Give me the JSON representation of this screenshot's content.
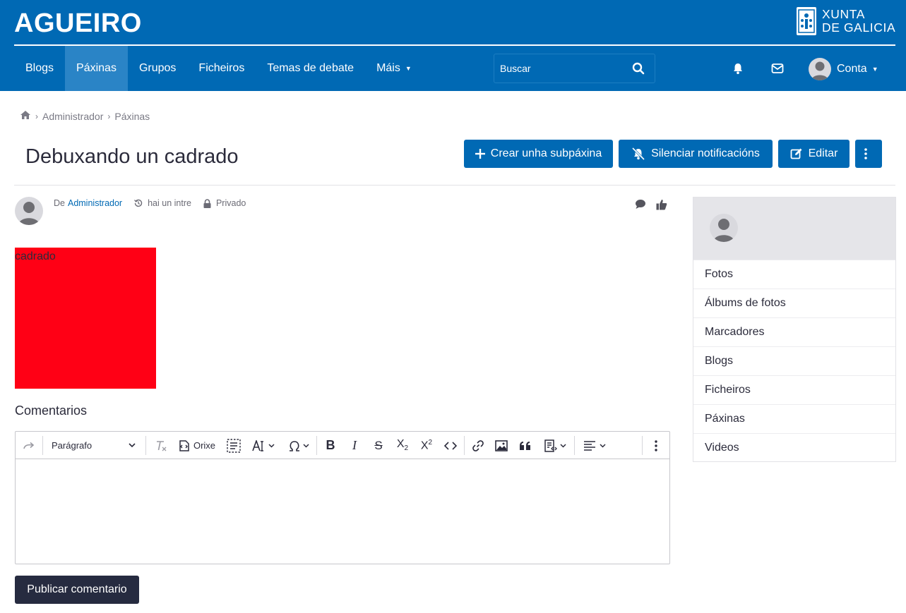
{
  "header": {
    "brand": "AGUEIRO",
    "org_line1": "XUNTA",
    "org_line2": "DE GALICIA",
    "nav": [
      {
        "label": "Blogs"
      },
      {
        "label": "Páxinas",
        "active": true
      },
      {
        "label": "Grupos"
      },
      {
        "label": "Ficheiros"
      },
      {
        "label": "Temas de debate"
      },
      {
        "label": "Máis"
      }
    ],
    "search_placeholder": "Buscar",
    "account_label": "Conta"
  },
  "breadcrumb": [
    "Administrador",
    "Páxinas"
  ],
  "page": {
    "title": "Debuxando un cadrado",
    "actions": {
      "create_subpage": "Crear unha subpáxina",
      "mute": "Silenciar notificacións",
      "edit": "Editar"
    },
    "meta": {
      "by_prefix": "De",
      "author": "Administrador",
      "time": "hai un intre",
      "access": "Privado"
    },
    "content_text": "cadrado",
    "content_color": "#ff0015"
  },
  "comments": {
    "title": "Comentarios",
    "paragraph_select": "Parágrafo",
    "source_label": "Orixe",
    "publish_label": "Publicar comentario"
  },
  "sidebar": {
    "items": [
      "Fotos",
      "Álbums de fotos",
      "Marcadores",
      "Blogs",
      "Ficheiros",
      "Páxinas",
      "Videos"
    ]
  },
  "colors": {
    "primary": "#0069b4",
    "dark_button": "#262b40"
  }
}
